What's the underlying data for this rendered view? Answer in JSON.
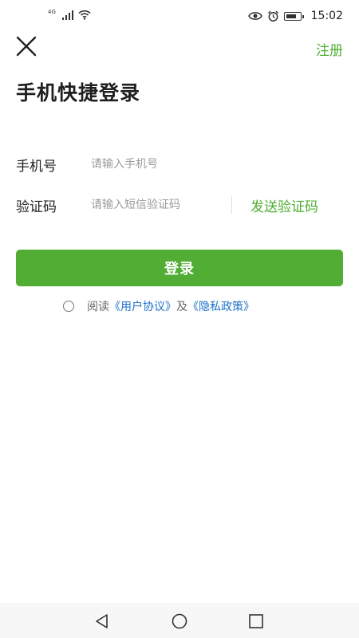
{
  "status_bar": {
    "network": "4G",
    "time": "15:02",
    "icons": [
      "signal-icon",
      "wifi-icon",
      "eye-icon",
      "alarm-icon",
      "battery-icon"
    ]
  },
  "header": {
    "close_icon": "close-icon",
    "register_label": "注册",
    "title": "手机快捷登录"
  },
  "form": {
    "phone": {
      "label": "手机号",
      "placeholder": "请输入手机号",
      "value": ""
    },
    "code": {
      "label": "验证码",
      "placeholder": "请输入短信验证码",
      "value": "",
      "send_label": "发送验证码"
    }
  },
  "login_button": {
    "label": "登录"
  },
  "agreement": {
    "prefix": "阅读",
    "user_agreement": "《用户协议》",
    "conjunction": "及",
    "privacy_policy": "《隐私政策》",
    "checked": false
  },
  "nav_bar": {
    "icons": [
      "back-icon",
      "home-icon",
      "recent-apps-icon"
    ]
  },
  "colors": {
    "accent": "#51ad34",
    "link": "#1e72c8"
  }
}
